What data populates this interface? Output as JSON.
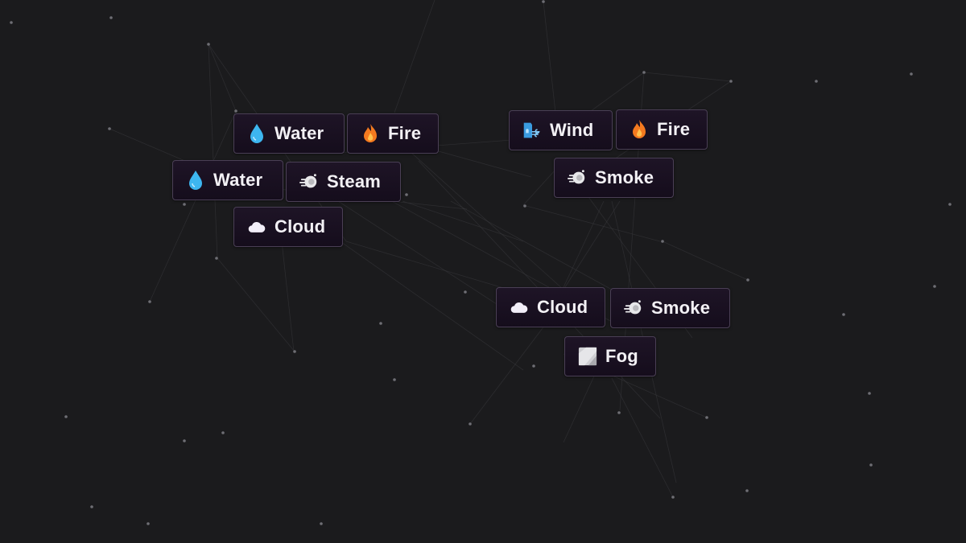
{
  "game": {
    "elements": [
      {
        "id": "water-1",
        "label": "Water",
        "icon": "water-drop-icon"
      },
      {
        "id": "fire-1",
        "label": "Fire",
        "icon": "fire-icon"
      },
      {
        "id": "water-2",
        "label": "Water",
        "icon": "water-drop-icon"
      },
      {
        "id": "steam-1",
        "label": "Steam",
        "icon": "steam-icon"
      },
      {
        "id": "cloud-1",
        "label": "Cloud",
        "icon": "cloud-icon"
      },
      {
        "id": "wind-1",
        "label": "Wind",
        "icon": "wind-icon"
      },
      {
        "id": "fire-2",
        "label": "Fire",
        "icon": "fire-icon"
      },
      {
        "id": "smoke-1",
        "label": "Smoke",
        "icon": "smoke-icon"
      },
      {
        "id": "cloud-2",
        "label": "Cloud",
        "icon": "cloud-icon"
      },
      {
        "id": "smoke-2",
        "label": "Smoke",
        "icon": "smoke-icon"
      },
      {
        "id": "fog-1",
        "label": "Fog",
        "icon": "fog-icon"
      }
    ]
  },
  "colors": {
    "background": "#1b1b1d",
    "tile_border": "#4a3f55",
    "tile_text": "#f3f1f5",
    "water": "#3db6f0",
    "fire": "#f47a1f",
    "wind": "#3a9be0"
  }
}
